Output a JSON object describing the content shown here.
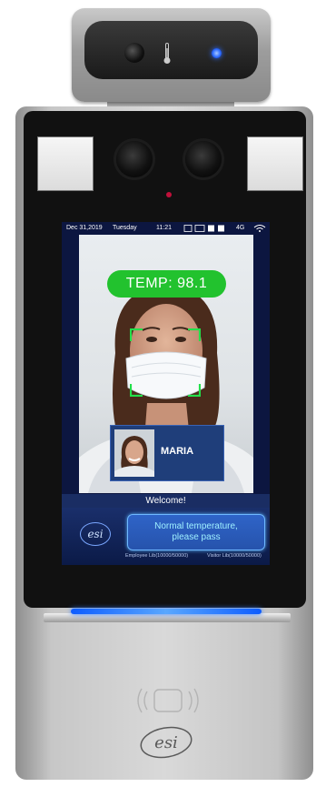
{
  "status_bar": {
    "date": "Dec 31,2019",
    "weekday": "Tuesday",
    "time": "11:21",
    "network": "4G"
  },
  "temperature_label": "TEMP: 98.1",
  "person_card": {
    "name": "MARIA"
  },
  "welcome_text": "Welcome!",
  "message": {
    "line1": "Normal temperature,",
    "line2": "please pass"
  },
  "mini_logo": "esi",
  "employee_lib": "Employee Lib(10000/50000)",
  "visitor_lib": "Visitor Lib(10000/50000)",
  "colors": {
    "temp_pill": "#22c22e",
    "screen_bg": "#0c1640",
    "message_text": "#9ff0ff",
    "led": "#2d6bff"
  },
  "icons": [
    "thermometer-icon",
    "face-scan-icon",
    "nfc-reader-icon",
    "esi-logo"
  ]
}
